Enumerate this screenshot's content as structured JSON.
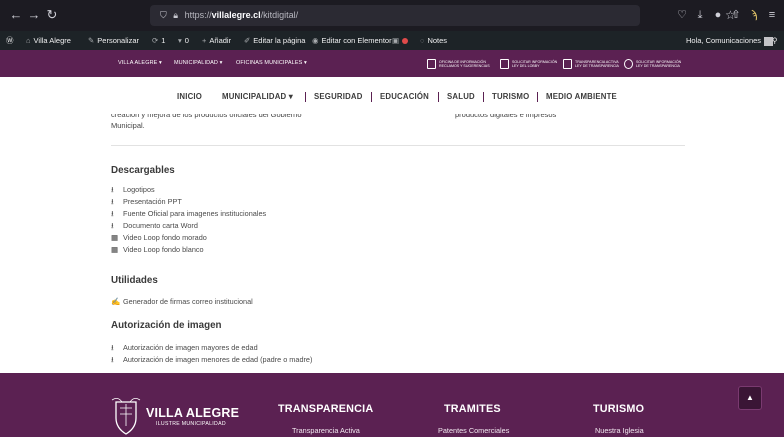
{
  "browser": {
    "back": "←",
    "forward": "→",
    "reload": "↻",
    "url_prefix": "https://",
    "url_domain": "villalegre.cl",
    "url_path": "/kitdigital/",
    "star": "☆",
    "icons": [
      "pocket-icon",
      "download-icon",
      "extension-icon",
      "share-icon",
      "menu-icon"
    ]
  },
  "admin_bar": {
    "site_name": "Villa Alegre",
    "customize": "Personalizar",
    "updates": "1",
    "comments": "0",
    "add": "Añadir",
    "edit_page": "Editar la página",
    "edit_elementor": "Editar con Elementor",
    "notes": "Notes",
    "greeting": "Hola, Comunicaciones"
  },
  "site_top": {
    "nav": [
      "VILLA ALEGRE ▾",
      "MUNICIPALIDAD ▾",
      "OFICINAS MUNICIPALES ▾"
    ],
    "badges": [
      {
        "line1": "OFICINA DE INFORMACIÓN",
        "line2": "RECLAMOS Y SUGERENCIAS"
      },
      {
        "line1": "SOLICITAR INFORMACIÓN",
        "line2": "LEY DEL LOBBY"
      },
      {
        "line1": "TRANSPARENCIA ACTIVA",
        "line2": "LEY DE TRANSPARENCIA"
      },
      {
        "line1": "SOLICITAR INFORMACIÓN",
        "line2": "LEY DE TRANSPARENCIA"
      }
    ]
  },
  "main_nav": {
    "items": [
      "INICIO",
      "MUNICIPALIDAD ▾",
      "SEGURIDAD",
      "EDUCACIÓN",
      "SALUD",
      "TURISMO",
      "MEDIO AMBIENTE"
    ]
  },
  "partial_text": {
    "left_line1": "creación y mejora de los productos oficiales del Gobierno",
    "left_line2": "Municipal.",
    "right_line1": "productos digitales e impresos"
  },
  "descargables": {
    "title": "Descargables",
    "items": [
      {
        "label": "Logotipos",
        "icon": "download-icon"
      },
      {
        "label": "Presentación PPT",
        "icon": "download-icon"
      },
      {
        "label": "Fuente Oficial para imagenes institucionales",
        "icon": "download-icon"
      },
      {
        "label": "Documento carta Word",
        "icon": "download-icon"
      },
      {
        "label": "Video Loop fondo morado",
        "icon": "video-icon"
      },
      {
        "label": "Video Loop fondo blanco",
        "icon": "video-icon"
      }
    ]
  },
  "utilidades": {
    "title": "Utilidades",
    "items": [
      {
        "label": "Generador de firmas correo institucional",
        "icon": "edit-document-icon"
      }
    ]
  },
  "autorizacion": {
    "title": "Autorización de imagen",
    "items": [
      {
        "label": "Autorización de imagen mayores de edad",
        "icon": "download-icon"
      },
      {
        "label": "Autorización de imagen menores de edad (padre o madre)",
        "icon": "download-icon"
      }
    ]
  },
  "footer": {
    "brand": "VILLA ALEGRE",
    "brand_sub": "ILUSTRE MUNICIPALIDAD",
    "columns": [
      {
        "title": "TRANSPARENCIA",
        "link": "Transparencia Activa"
      },
      {
        "title": "TRAMITES",
        "link": "Patentes Comerciales"
      },
      {
        "title": "TURISMO",
        "link": "Nuestra Iglesia"
      }
    ],
    "back_to_top": "▲"
  },
  "colors": {
    "brand_purple": "#5b2152",
    "browser_dark": "#1c1b22",
    "admin_dark": "#1d2327"
  }
}
